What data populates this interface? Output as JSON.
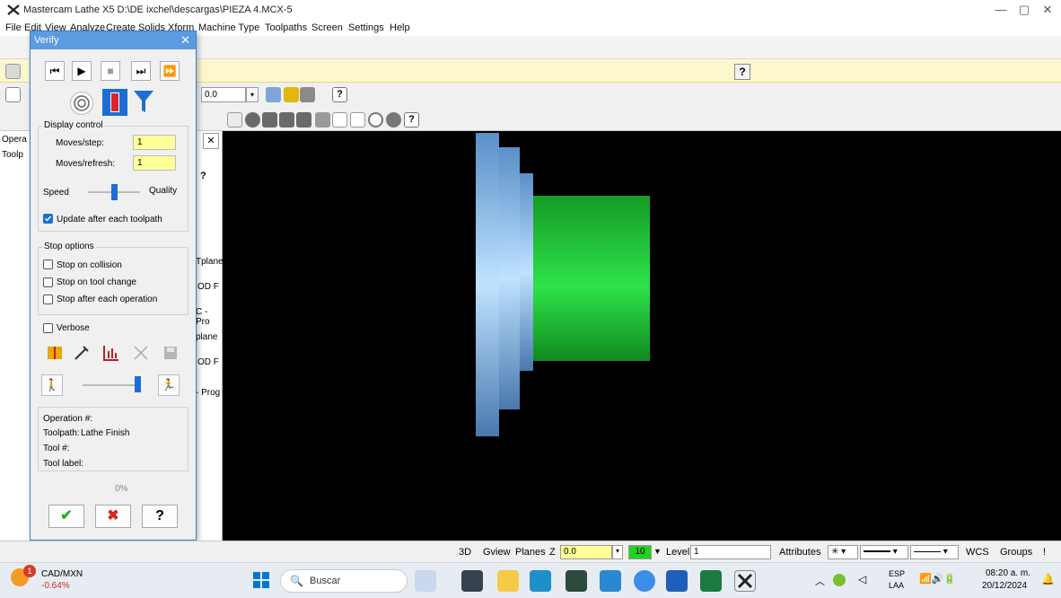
{
  "window": {
    "title": "Mastercam Lathe X5  D:\\DE ixchel\\descargas\\PIEZA 4.MCX-5",
    "min_label": "—",
    "max_label": "▢",
    "close_label": "✕"
  },
  "menu": {
    "items": [
      "File",
      "Edit",
      "View",
      "Analyze",
      "Create",
      "Solids",
      "Xform",
      "Machine Type",
      "Toolpaths",
      "Screen",
      "Settings",
      "Help"
    ]
  },
  "toolbar": {
    "z_value": "0.0",
    "help_label": "?"
  },
  "left_panel": {
    "tab_ops": "Opera",
    "tab_toolp": "Toolp",
    "labels": [
      "Tplane",
      "OD F",
      "C - Pro",
      "plane",
      "OD F",
      "- Prog"
    ],
    "close_label": "✕"
  },
  "verify_dialog": {
    "title": "Verify",
    "close_label": "✕",
    "playback": [
      "⏮",
      "▶",
      "■",
      "⏭",
      "⏩"
    ],
    "display_control": {
      "heading": "Display control",
      "moves_step_label": "Moves/step:",
      "moves_step_value": "1",
      "moves_refresh_label": "Moves/refresh:",
      "moves_refresh_value": "1",
      "speed_label": "Speed",
      "quality_label": "Quality",
      "speed_quality": 0.5,
      "update_label": "Update after each toolpath",
      "update_checked": true
    },
    "stop_options": {
      "heading": "Stop options",
      "collision_label": "Stop on collision",
      "tool_change_label": "Stop on tool change",
      "after_op_label": "Stop after each operation"
    },
    "verbose_label": "Verbose",
    "info": {
      "operation_label": "Operation #:",
      "operation_value": "",
      "toolpath_label": "Toolpath:",
      "toolpath_value": "Lathe Finish",
      "tool_label": "Tool #:",
      "tool_value": "",
      "toollabel_label": "Tool label:",
      "toollabel_value": ""
    },
    "progress_label": "0%",
    "progress": 0,
    "ok_label": "✔",
    "cancel_label": "✖",
    "help_label": "?"
  },
  "statusbar": {
    "mode": "3D",
    "gview": "Gview",
    "planes": "Planes",
    "z_label": "Z",
    "z_value": "0.0",
    "color_value": "10",
    "level_label": "Level",
    "level_value": "1",
    "attributes_label": "Attributes",
    "wcs_label": "WCS",
    "groups_label": "Groups",
    "bang": "!"
  },
  "taskbar": {
    "ticker_name": "CAD/MXN",
    "ticker_change": "-0.64%",
    "ticker_badge": "1",
    "search_placeholder": "Buscar",
    "lang_top": "ESP",
    "lang_bottom": "LAA",
    "time": "08:20 a. m.",
    "date": "20/12/2024"
  },
  "colors": {
    "part_green": "#1fc634",
    "chuck_blue": "#5a8fc8",
    "accent": "#1c6ed3",
    "field_yellow": "#ffff99"
  }
}
